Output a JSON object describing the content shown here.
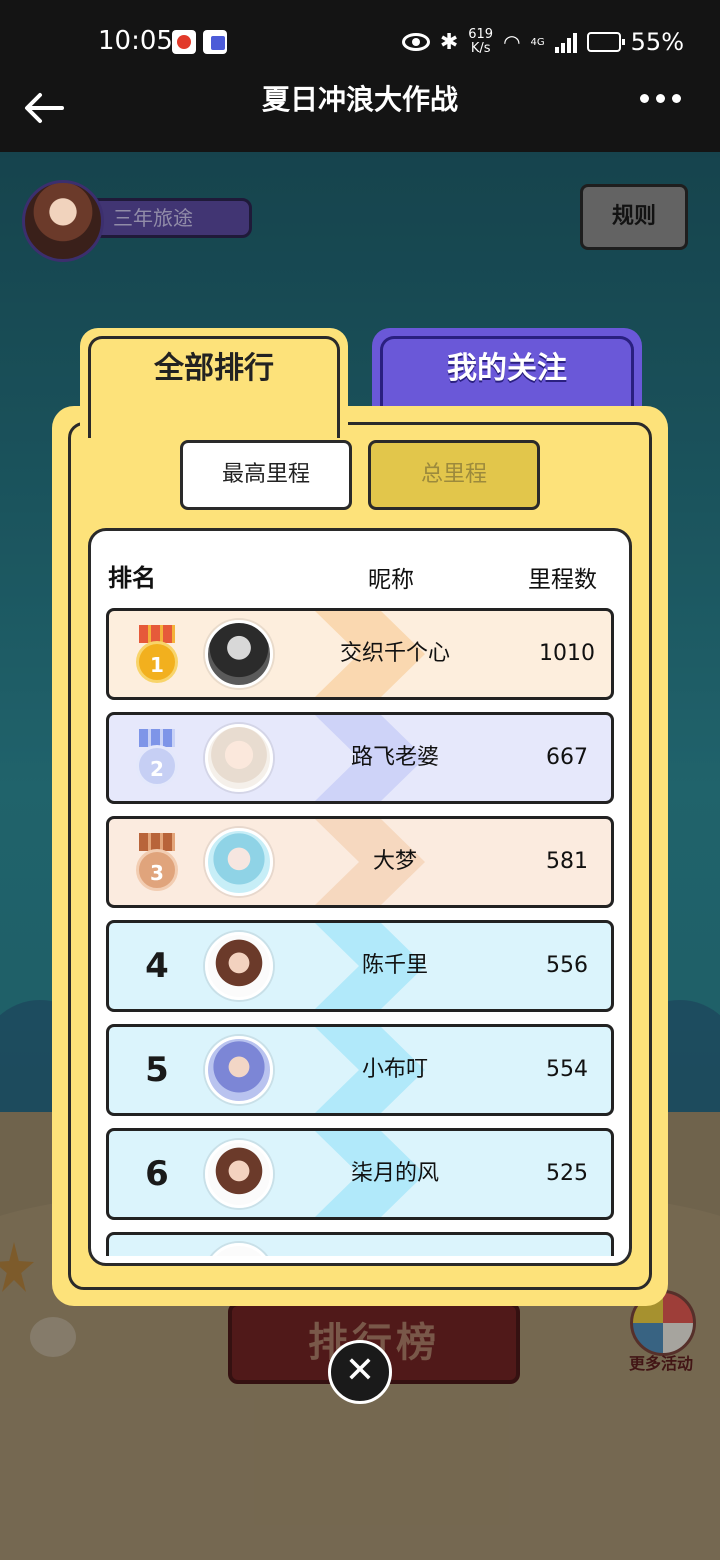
{
  "status_bar": {
    "time": "10:05",
    "net_speed_value": "619",
    "net_speed_unit": "K/s",
    "network": "4G",
    "battery": "55%"
  },
  "titlebar": {
    "title": "夏日冲浪大作战",
    "back_icon": "back-arrow-icon",
    "more_icon": "more-dots-icon"
  },
  "profile": {
    "username": "三年旅途"
  },
  "rules_button": "规则",
  "tabs": [
    {
      "label": "全部排行",
      "active": true
    },
    {
      "label": "我的关注",
      "active": false
    }
  ],
  "segments": [
    {
      "label": "最高里程",
      "active": true
    },
    {
      "label": "总里程",
      "active": false
    }
  ],
  "leaderboard": {
    "headers": {
      "rank": "排名",
      "nickname": "昵称",
      "distance": "里程数"
    },
    "rows": [
      {
        "rank": "1",
        "nickname": "交织千个心",
        "distance": "1010"
      },
      {
        "rank": "2",
        "nickname": "路飞老婆",
        "distance": "667"
      },
      {
        "rank": "3",
        "nickname": "大梦",
        "distance": "581"
      },
      {
        "rank": "4",
        "nickname": "陈千里",
        "distance": "556"
      },
      {
        "rank": "5",
        "nickname": "小布叮",
        "distance": "554"
      },
      {
        "rank": "6",
        "nickname": "柒月的风",
        "distance": "525"
      }
    ]
  },
  "background": {
    "banner": "排行榜",
    "more_activities": "更多活动"
  },
  "close_icon": "close-x-icon",
  "colors": {
    "panel_yellow": "#fde27a",
    "tab_purple": "#6a58d8",
    "gold": "#f2b01e",
    "silver": "#b7c2f0",
    "bronze": "#d79a6e",
    "row_cyan": "#dbf4fc"
  }
}
